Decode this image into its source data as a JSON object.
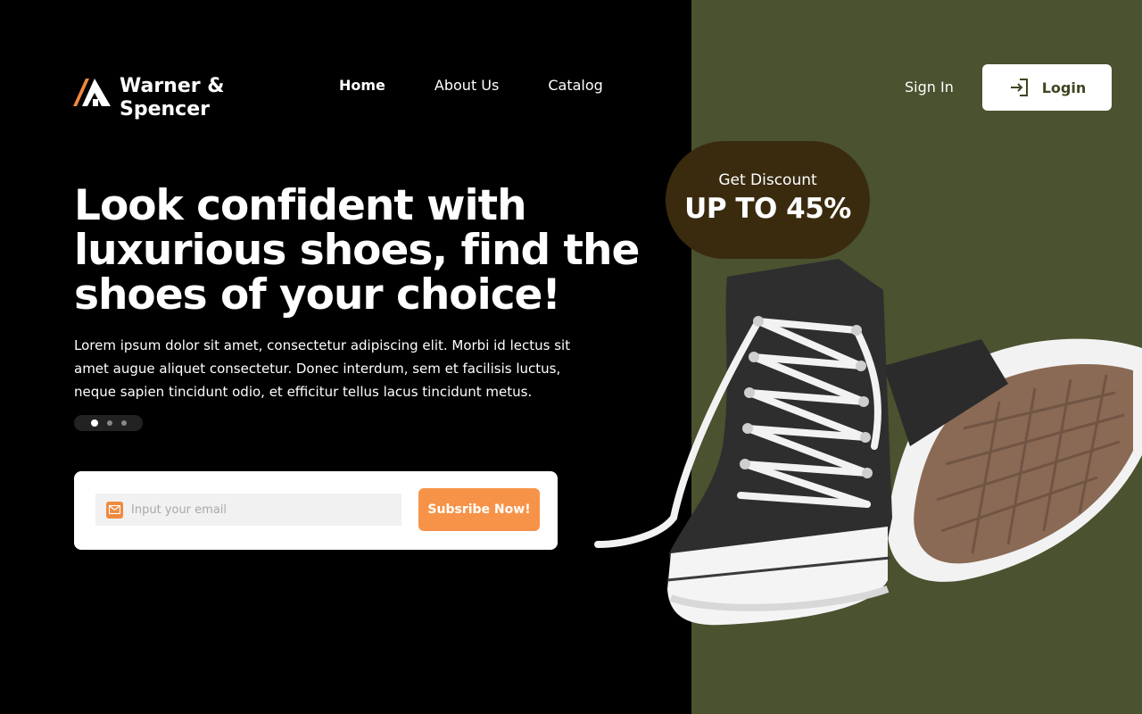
{
  "brand": {
    "name": "Warner & Spencer",
    "logo_icon": "triangle-logo-icon",
    "accent": "#f08a3e"
  },
  "nav": {
    "items": [
      {
        "label": "Home",
        "active": true
      },
      {
        "label": "About Us",
        "active": false
      },
      {
        "label": "Catalog",
        "active": false
      }
    ]
  },
  "auth": {
    "signin_label": "Sign In",
    "login_label": "Login",
    "login_icon": "login-icon"
  },
  "hero": {
    "headline": "Look confident with luxurious shoes, find the shoes of your choice!",
    "description": "Lorem ipsum dolor sit amet, consectetur adipiscing elit. Morbi id lectus sit amet augue aliquet consectetur. Donec interdum, sem et facilisis luctus, neque sapien tincidunt odio, et efficitur tellus lacus tincidunt metus.",
    "carousel": {
      "total": 3,
      "active_index": 0
    }
  },
  "subscribe": {
    "placeholder": "Input your email",
    "button_label": "Subsribe Now!",
    "icon": "mail-icon"
  },
  "discount": {
    "label": "Get Discount",
    "value": "UP TO 45%"
  },
  "colors": {
    "panel_green": "#4a522f",
    "badge_brown": "#3a2b0f",
    "button_orange": "#f79348"
  }
}
